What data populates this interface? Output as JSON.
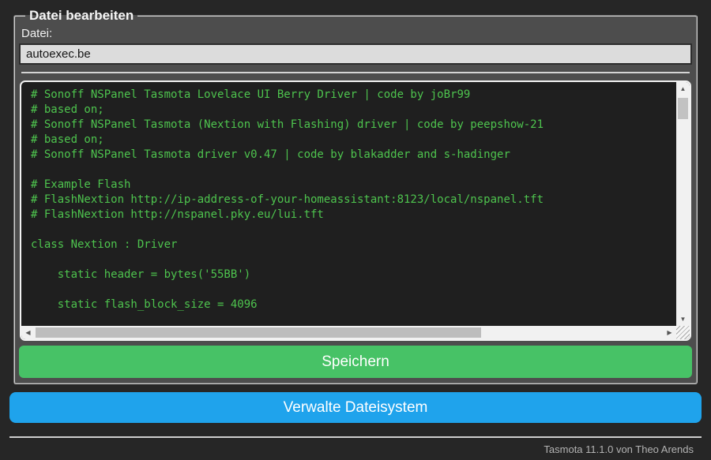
{
  "editor": {
    "legend": "Datei bearbeiten",
    "file_label": "Datei:",
    "file_input_value": "autoexec.be",
    "code_lines": [
      "# Sonoff NSPanel Tasmota Lovelace UI Berry Driver | code by joBr99",
      "# based on;",
      "# Sonoff NSPanel Tasmota (Nextion with Flashing) driver | code by peepshow-21",
      "# based on;",
      "# Sonoff NSPanel Tasmota driver v0.47 | code by blakadder and s-hadinger",
      "",
      "# Example Flash",
      "# FlashNextion http://ip-address-of-your-homeassistant:8123/local/nspanel.tft",
      "# FlashNextion http://nspanel.pky.eu/lui.tft",
      "",
      "class Nextion : Driver",
      "",
      "    static header = bytes('55BB')",
      "",
      "    static flash_block_size = 4096"
    ],
    "save_button_label": "Speichern"
  },
  "actions": {
    "manage_filesystem_button_label": "Verwalte Dateisystem"
  },
  "footer": {
    "text": "Tasmota 11.1.0 von Theo Arends"
  },
  "icons": {
    "scroll_up": "▲",
    "scroll_down": "▼",
    "scroll_left": "◀",
    "scroll_right": "▶"
  },
  "colors": {
    "page_background": "#262626",
    "panel_background": "#4d4d4d",
    "code_background": "#1f1f1f",
    "code_text": "#4ec44e",
    "save_button": "#47c266",
    "manage_button": "#1fa3ec",
    "input_background": "#dcdcdc"
  }
}
